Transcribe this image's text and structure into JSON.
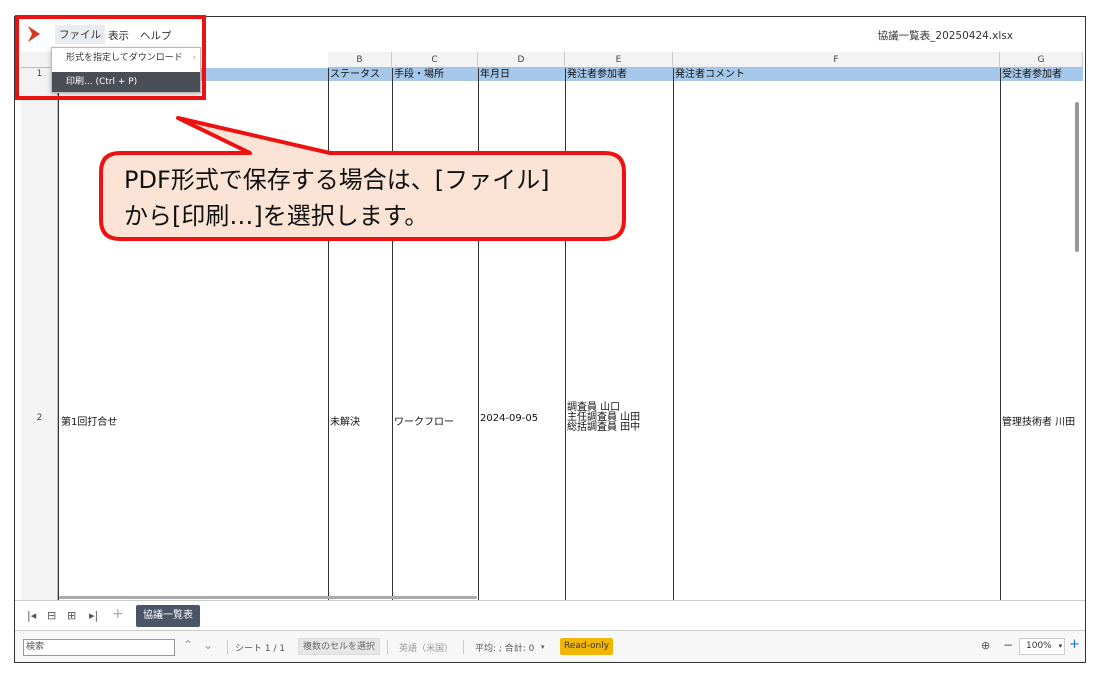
{
  "app": {
    "menu": [
      "ファイル",
      "表示",
      "ヘルプ"
    ],
    "doc_title": "協議一覧表_20250424.xlsx"
  },
  "file_menu": {
    "items": [
      "形式を指定してダウンロード",
      "印刷... (Ctrl + P)"
    ]
  },
  "sheet": {
    "columns": [
      "B",
      "C",
      "D",
      "E",
      "F",
      "G"
    ],
    "row_numbers": [
      "1",
      "2"
    ],
    "headers": [
      "ステータス",
      "手段・場所",
      "年月日",
      "発注者参加者",
      "発注者コメント",
      "受注者参加者"
    ],
    "row2": {
      "a": "第1回打合せ",
      "b": "未解決",
      "c": "ワークフロー",
      "d": "2024-09-05",
      "e": [
        "調査員 山口",
        "主任調査員 山田",
        "総括調査員 田中"
      ],
      "g": "管理技術者 川田"
    }
  },
  "sheet_tab": "協議一覧表",
  "status": {
    "search_placeholder": "検索",
    "sheet_count": "シート 1 / 1",
    "multi_select": "複数のセルを選択",
    "language": "英語（米国）",
    "sum": "平均: ; 合計: 0",
    "read_only": "Read-only",
    "zoom": "100%"
  },
  "callout": {
    "line1": "PDF形式で保存する場合は、[ファイル]",
    "line2": "から[印刷…]を選択します。"
  }
}
